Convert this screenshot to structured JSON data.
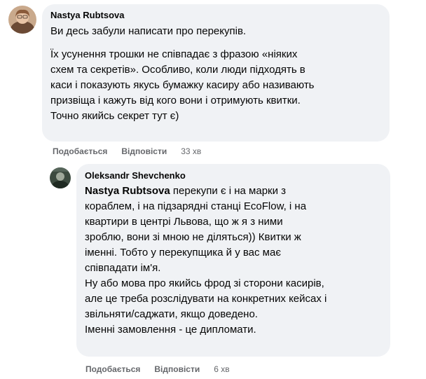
{
  "comments": [
    {
      "author": "Nastya Rubtsova",
      "paragraphs": [
        [
          "Ви десь забули написати про перекупів."
        ],
        [
          "Їх усунення трошки не співпадає з фразою «ніяких",
          "схем та секретів». Особливо, коли люди підходять в",
          "каси і показують якусь бумажку касиру або називають",
          "призвіща і кажуть від кого вони і отримують квитки.",
          "Точно якийсь секрет тут є)"
        ]
      ],
      "actions": {
        "like": "Подобається",
        "reply": "Відповісти",
        "time": "33 хв"
      }
    },
    {
      "author": "Oleksandr Shevchenko",
      "mention": "Nastya Rubtsova",
      "lines": [
        "перекупи є і на марки з",
        "кораблем, і на підзарядні станці EcoFlow, і на",
        "квартири в центрі Львова, що ж я з ними",
        "зроблю, вони зі мною не діляться)) Квитки ж",
        "іменні. Тобто у перекупщика й у вас має",
        "співпадати ім'я.",
        "Ну або мова про якийсь фрод зі сторони касирів,",
        "але це треба розслідувати на конкретних кейсах і",
        "звільняти/саджати, якщо доведено.",
        "Іменні замовлення - це дипломати."
      ],
      "actions": {
        "like": "Подобається",
        "reply": "Відповісти",
        "time": "6 хв"
      }
    }
  ]
}
